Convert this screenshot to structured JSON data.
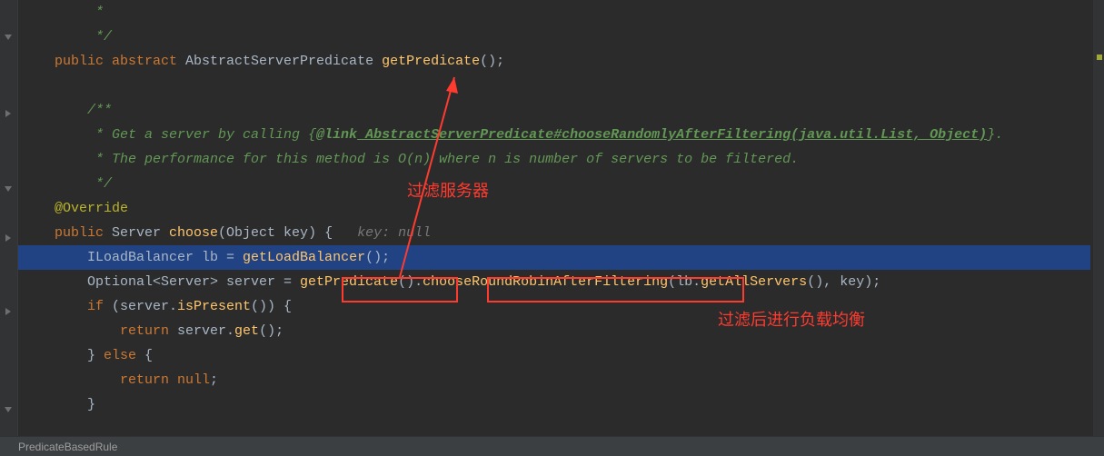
{
  "gutter_icons": [
    "fold",
    "fold",
    "fold",
    "fold",
    "fold",
    "fold"
  ],
  "code": {
    "l0": "     *",
    "l1": "     */",
    "l2a": "public",
    "l2b": " abstract",
    "l2c": " AbstractServerPredicate ",
    "l2d": "getPredicate",
    "l2e": "();",
    "l3": "",
    "l4": "    /**",
    "l5a": "     * Get a server by calling {",
    "l5b": "@link",
    "l5c": " AbstractServerPredicate#chooseRandomlyAfterFiltering(java.util.List, Object)",
    "l5d": "}.",
    "l6": "     * The performance for this method is O(n) where n is number of servers to be filtered.",
    "l7": "     */",
    "l8": "@Override",
    "l9a": "public ",
    "l9b": "Server ",
    "l9c": "choose",
    "l9d": "(Object key) {   ",
    "l9e": "key: null",
    "l10a": "    ILoadBalancer lb = ",
    "l10b": "getLoadBalancer",
    "l10c": "();",
    "l11a": "    Optional<Server> server = ",
    "l11b": "getPredicate",
    "l11c": "().",
    "l11d": "chooseRoundRobinAfterFiltering",
    "l11e": "(lb.",
    "l11f": "getAllServers",
    "l11g": "(), key);",
    "l12a": "    if",
    "l12b": " (server.",
    "l12c": "isPresent",
    "l12d": "()) {",
    "l13a": "        return",
    "l13b": " server.",
    "l13c": "get",
    "l13d": "();",
    "l14a": "    } ",
    "l14b": "else",
    "l14c": " {",
    "l15a": "        return null",
    "l15b": ";",
    "l16": "    }",
    "l17": ""
  },
  "annotations": {
    "label1": "过滤服务器",
    "label2": "过滤后进行负载均衡"
  },
  "breadcrumb": "PredicateBasedRule",
  "colors": {
    "background": "#2b2b2b",
    "highlight_line": "#214283",
    "comment": "#629755",
    "keyword": "#cc7832",
    "method": "#ffc66d",
    "annotation_yellow": "#bbb529",
    "red_annotation": "#ff3b30"
  }
}
